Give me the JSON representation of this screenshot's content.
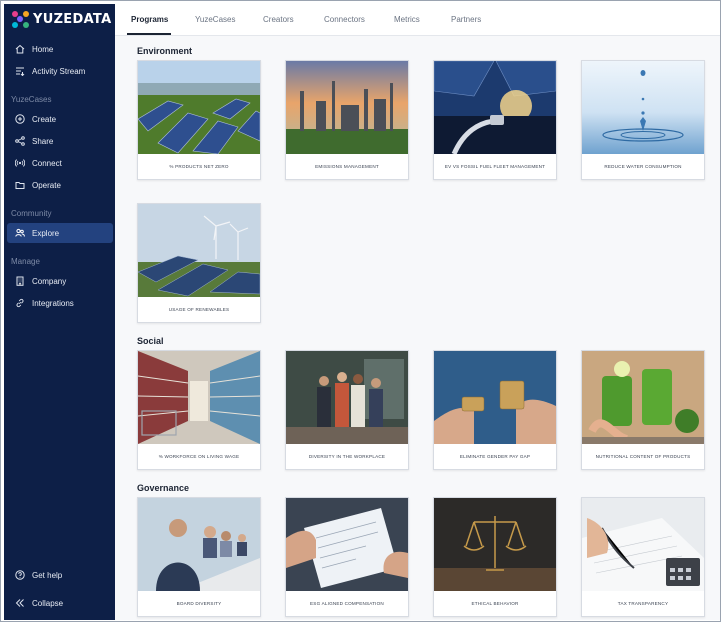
{
  "brand": {
    "name": "YUZEDATA"
  },
  "sidebar": {
    "items": [
      {
        "label": "Home",
        "icon": "home-icon"
      },
      {
        "label": "Activity Stream",
        "icon": "activity-stream-icon"
      }
    ],
    "sections": [
      {
        "label": "YuzeCases",
        "items": [
          {
            "label": "Create",
            "icon": "plus-circle-icon"
          },
          {
            "label": "Share",
            "icon": "share-icon"
          },
          {
            "label": "Connect",
            "icon": "broadcast-icon"
          },
          {
            "label": "Operate",
            "icon": "folder-icon"
          }
        ]
      },
      {
        "label": "Community",
        "items": [
          {
            "label": "Explore",
            "icon": "people-icon",
            "active": true
          }
        ]
      },
      {
        "label": "Manage",
        "items": [
          {
            "label": "Company",
            "icon": "building-icon"
          },
          {
            "label": "Integrations",
            "icon": "link-icon"
          }
        ]
      }
    ],
    "footer": [
      {
        "label": "Get help",
        "icon": "help-icon"
      },
      {
        "label": "Collapse",
        "icon": "collapse-icon"
      }
    ]
  },
  "tabs": [
    {
      "label": "Programs",
      "active": true
    },
    {
      "label": "YuzeCases"
    },
    {
      "label": "Creators"
    },
    {
      "label": "Connectors"
    },
    {
      "label": "Metrics"
    },
    {
      "label": "Partners"
    }
  ],
  "sections": [
    {
      "title": "Environment",
      "cards": [
        "% PRODUCTS NET ZERO",
        "EMISSIONS MANAGEMENT",
        "EV VS FOSSIL FUEL FLEET MANAGEMENT",
        "REDUCE WATER CONSUMPTION",
        "USAGE OF RENEWABLES"
      ]
    },
    {
      "title": "Social",
      "cards": [
        "% WORKFORCE ON LIVING WAGE",
        "DIVERSITY IN THE WORKPLACE",
        "ELIMINATE GENDER PAY GAP",
        "NUTRITIONAL CONTENT OF PRODUCTS"
      ]
    },
    {
      "title": "Governance",
      "cards": [
        "BOARD DIVERSITY",
        "ESG ALIGNED COMPENSATION",
        "ETHICAL BEHAVIOR",
        "TAX TRANSPARENCY"
      ]
    }
  ],
  "colors": {
    "sidebar": "#0d1f47",
    "active": "#23427f",
    "background": "#f7f8fa"
  }
}
